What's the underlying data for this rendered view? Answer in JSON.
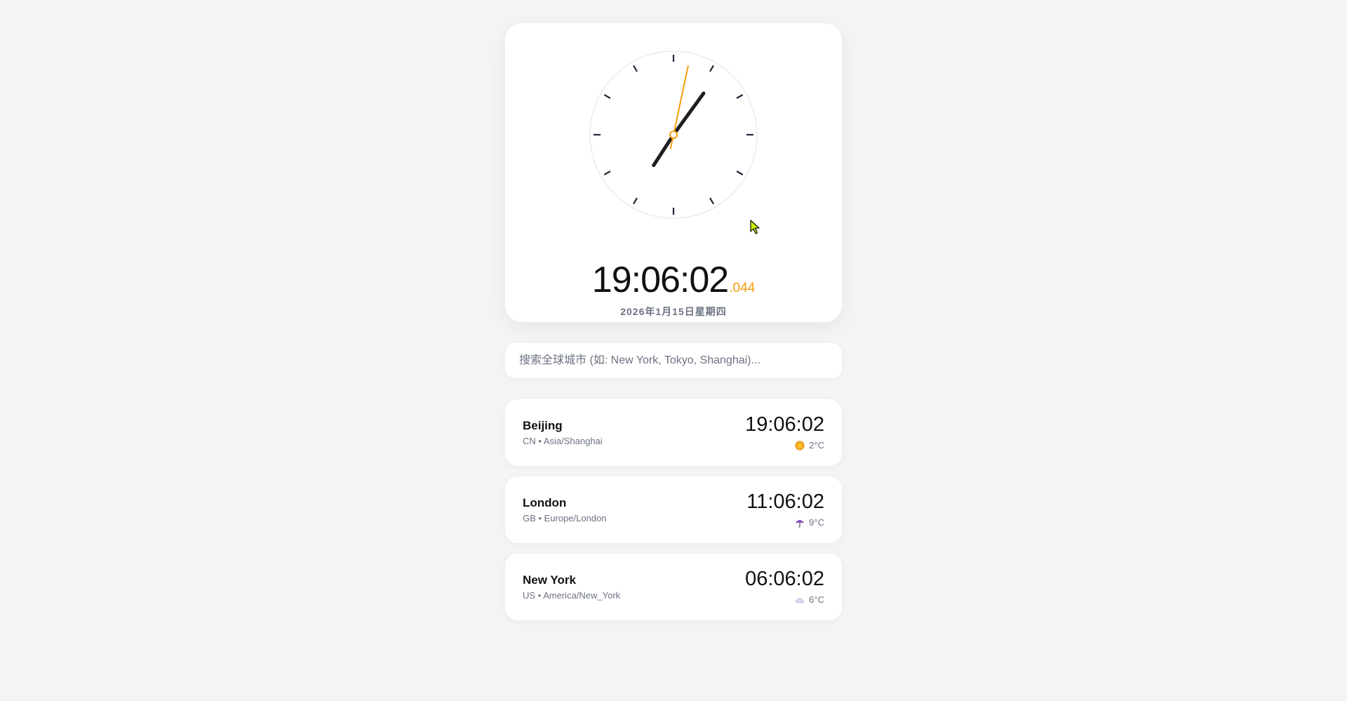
{
  "clock": {
    "hour_hand_angle_deg": 213,
    "minute_hand_angle_deg": 36,
    "second_hand_angle_deg": 12,
    "time_main": "19:06:02",
    "time_ms": ".044",
    "date": "2026年1月15日星期四",
    "accent_color": "#f59e0b"
  },
  "search": {
    "placeholder": "搜索全球城市 (如: New York, Tokyo, Shanghai)..."
  },
  "cities": [
    {
      "name": "Beijing",
      "sub": "CN • Asia/Shanghai",
      "time": "19:06:02",
      "temp": "2°C",
      "weather_icon": "sun-icon"
    },
    {
      "name": "London",
      "sub": "GB • Europe/London",
      "time": "11:06:02",
      "temp": "9°C",
      "weather_icon": "umbrella-icon"
    },
    {
      "name": "New York",
      "sub": "US • America/New_York",
      "time": "06:06:02",
      "temp": "6°C",
      "weather_icon": "cloud-icon"
    }
  ]
}
